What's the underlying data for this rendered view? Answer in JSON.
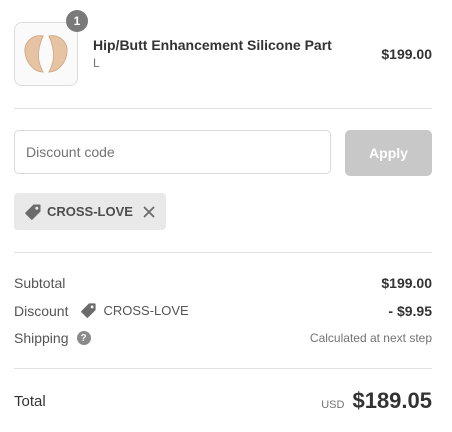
{
  "product": {
    "quantity": "1",
    "name": "Hip/Butt Enhancement Silicone Part",
    "variant": "L",
    "price": "$199.00",
    "thumbnail_color": "#e8c4a4"
  },
  "discount": {
    "placeholder": "Discount code",
    "value": "",
    "apply_label": "Apply",
    "applied_code": "CROSS-LOVE"
  },
  "summary": {
    "subtotal_label": "Subtotal",
    "subtotal_value": "$199.00",
    "discount_label": "Discount",
    "discount_code": "CROSS-LOVE",
    "discount_value": "- $9.95",
    "shipping_label": "Shipping",
    "shipping_help": "?",
    "shipping_value": "Calculated at next step"
  },
  "total": {
    "label": "Total",
    "currency": "USD",
    "amount": "$189.05"
  },
  "colors": {
    "apply_disabled": "#c8c8c8",
    "chip_background": "#e9e9e9",
    "badge": "#7a7a7a"
  },
  "icons": {
    "tag": "tag-icon",
    "close": "close-icon",
    "help": "question-icon"
  }
}
